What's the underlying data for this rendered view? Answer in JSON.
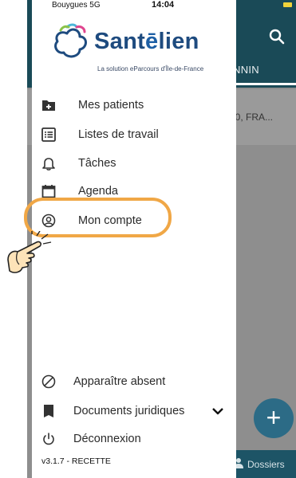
{
  "status_bar": {
    "carrier": "Bouygues 5G",
    "time": "14:04"
  },
  "background_app": {
    "tab_label": "NNIN",
    "row_text": "D0, FRA...",
    "fab_label": "+",
    "bottom_tab_label": "Dossiers"
  },
  "drawer": {
    "logo": {
      "wordmark_prefix": "Sant",
      "wordmark_e": "ē",
      "wordmark_suffix": "lien",
      "tagline": "La solution eParcours d'Île-de-France"
    },
    "menu": [
      {
        "label": "Mes patients",
        "icon": "add-folder-icon"
      },
      {
        "label": "Listes de travail",
        "icon": "list-icon"
      },
      {
        "label": "Tâches",
        "icon": "bell-icon"
      },
      {
        "label": "Agenda",
        "icon": "calendar-icon"
      },
      {
        "label": "Mon compte",
        "icon": "user-circle-icon"
      }
    ],
    "bottom_menu": [
      {
        "label": "Apparaître absent",
        "icon": "do-not-disturb-icon"
      },
      {
        "label": "Documents juridiques",
        "icon": "document-icon",
        "expand": "chevron-down-icon"
      },
      {
        "label": "Déconnexion",
        "icon": "power-icon"
      }
    ],
    "version": "v3.1.7 - RECETTE"
  },
  "annotation": {
    "highlight_color": "#f0a746",
    "pointer": "hand-pointer-icon"
  },
  "colors": {
    "header": "#1a4a57",
    "brand_blue": "#1e4b7f",
    "fab": "#2c6b86"
  }
}
